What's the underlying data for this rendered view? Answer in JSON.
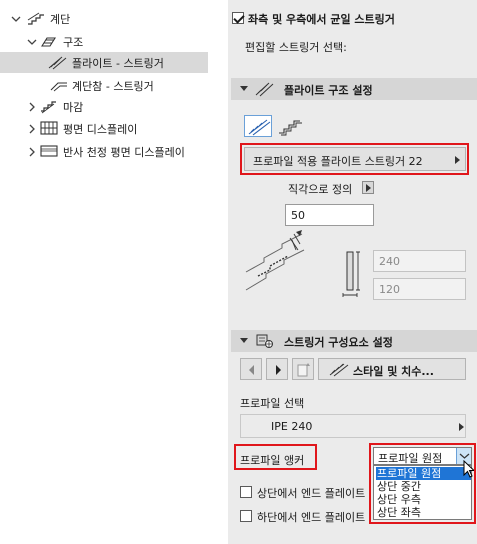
{
  "tree": {
    "root": {
      "label": "계단",
      "icon": "stair-icon"
    },
    "structure": {
      "label": "구조",
      "icon": "structure-icon"
    },
    "flight_stringer": {
      "label": "플라이트 - 스트링거",
      "icon": "flight-stringer-icon"
    },
    "landing_stringer": {
      "label": "계단참 - 스트링거",
      "icon": "landing-stringer-icon"
    },
    "finish": {
      "label": "마감",
      "icon": "finish-icon"
    },
    "floor_plan_display": {
      "label": "평면 디스플레이",
      "icon": "floor-plan-icon"
    },
    "rcp_display": {
      "label": "반사 천정 평면 디스플레이",
      "icon": "reflected-ceiling-icon"
    }
  },
  "panel": {
    "equal_stringers_label": "좌측 및 우측에서 균일 스트링거",
    "equal_stringers_checked": true,
    "select_stringer_label": "편집할 스트링거 선택:",
    "flight_structure": {
      "header": "플라이트 구조 설정",
      "type_button": "프로파일 적용 플라이트 스트링거 22",
      "perpendicular_label": "직각으로 정의",
      "depth_value": "50",
      "width_value": "240",
      "height_value": "120"
    },
    "stringer_components": {
      "header": "스트링거 구성요소 설정",
      "style_button": "스타일 및 치수...",
      "profile_select_label": "프로파일 선택",
      "profile_value": "IPE 240",
      "profile_anchor_label": "프로파일 앵커",
      "anchor_selected": "프로파일 원점",
      "anchor_options": [
        "프로파일 원점",
        "상단 중간",
        "상단 우측",
        "상단 좌측"
      ],
      "end_plate_top_label": "상단에서 엔드 플레이트",
      "end_plate_bottom_label": "하단에서 엔드 플레이트"
    }
  },
  "colors": {
    "highlight_red": "#e0161b",
    "selection_blue": "#1f75d6",
    "panel_bg": "#ebebeb",
    "header_bg": "#d6d6d6"
  }
}
